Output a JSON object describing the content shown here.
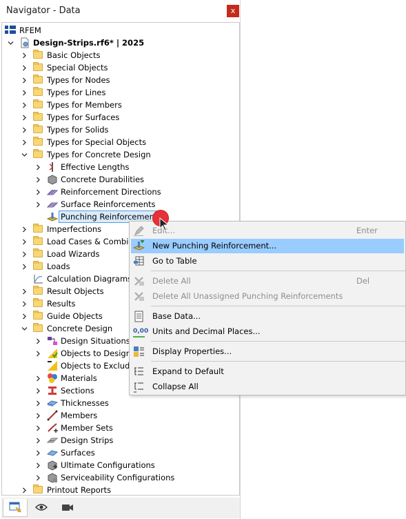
{
  "window": {
    "title": "Navigator - Data",
    "close_label": "x"
  },
  "tree": {
    "root_label": "RFEM",
    "project_label": "Design-Strips.rf6* | 2025",
    "rows": [
      {
        "label": "Basic Objects",
        "icon": "folder-icon"
      },
      {
        "label": "Special Objects",
        "icon": "folder-icon"
      },
      {
        "label": "Types for Nodes",
        "icon": "folder-icon"
      },
      {
        "label": "Types for Lines",
        "icon": "folder-icon"
      },
      {
        "label": "Types for Members",
        "icon": "folder-icon"
      },
      {
        "label": "Types for Surfaces",
        "icon": "folder-icon"
      },
      {
        "label": "Types for Solids",
        "icon": "folder-icon"
      },
      {
        "label": "Types for Special Objects",
        "icon": "folder-icon"
      },
      {
        "label": "Types for Concrete Design",
        "icon": "folder-icon"
      },
      {
        "label": "Effective Lengths",
        "icon": "effective-lengths-icon"
      },
      {
        "label": "Concrete Durabilities",
        "icon": "concrete-durability-icon"
      },
      {
        "label": "Reinforcement Directions",
        "icon": "reinforcement-directions-icon"
      },
      {
        "label": "Surface Reinforcements",
        "icon": "surface-reinforcement-icon"
      },
      {
        "label": "Punching Reinforcements",
        "icon": "punching-reinforcement-icon"
      },
      {
        "label": "Imperfections",
        "icon": "folder-icon"
      },
      {
        "label": "Load Cases & Combina",
        "icon": "folder-icon"
      },
      {
        "label": "Load Wizards",
        "icon": "folder-icon"
      },
      {
        "label": "Loads",
        "icon": "folder-icon"
      },
      {
        "label": "Calculation Diagrams",
        "icon": "diagram-icon"
      },
      {
        "label": "Result Objects",
        "icon": "folder-icon"
      },
      {
        "label": "Results",
        "icon": "folder-icon"
      },
      {
        "label": "Guide Objects",
        "icon": "folder-icon"
      },
      {
        "label": "Concrete Design",
        "icon": "folder-icon"
      },
      {
        "label": "Design Situations",
        "icon": "design-situations-icon"
      },
      {
        "label": "Objects to Design",
        "icon": "objects-to-design-icon"
      },
      {
        "label": "Objects to Exclude",
        "icon": "objects-to-exclude-icon"
      },
      {
        "label": "Materials",
        "icon": "materials-icon"
      },
      {
        "label": "Sections",
        "icon": "sections-icon"
      },
      {
        "label": "Thicknesses",
        "icon": "thickness-icon"
      },
      {
        "label": "Members",
        "icon": "member-icon"
      },
      {
        "label": "Member Sets",
        "icon": "member-set-icon"
      },
      {
        "label": "Design Strips",
        "icon": "design-strip-icon"
      },
      {
        "label": "Surfaces",
        "icon": "surface-icon"
      },
      {
        "label": "Ultimate Configurations",
        "icon": "ultimate-config-icon"
      },
      {
        "label": "Serviceability Configurations",
        "icon": "serviceability-config-icon"
      },
      {
        "label": "Printout Reports",
        "icon": "folder-icon"
      }
    ]
  },
  "context_menu": {
    "items": [
      {
        "label": "Edit...",
        "shortcut": "Enter",
        "icon": "edit-icon",
        "disabled": true
      },
      {
        "label": "New Punching Reinforcement...",
        "shortcut": "",
        "icon": "new-punching-icon",
        "disabled": false
      },
      {
        "label": "Go to Table",
        "shortcut": "",
        "icon": "table-icon",
        "disabled": false
      },
      {
        "label": "Delete All",
        "shortcut": "Del",
        "icon": "delete-icon",
        "disabled": true
      },
      {
        "label": "Delete All Unassigned Punching Reinforcements",
        "shortcut": "",
        "icon": "delete-unassigned-icon",
        "disabled": true
      },
      {
        "label": "Base Data...",
        "shortcut": "",
        "icon": "base-data-icon",
        "disabled": false
      },
      {
        "label": "Units and Decimal Places...",
        "shortcut": "",
        "icon": "units-icon",
        "disabled": false
      },
      {
        "label": "Display Properties...",
        "shortcut": "",
        "icon": "display-properties-icon",
        "disabled": false
      },
      {
        "label": "Expand to Default",
        "shortcut": "",
        "icon": "expand-icon",
        "disabled": false
      },
      {
        "label": "Collapse All",
        "shortcut": "",
        "icon": "collapse-icon",
        "disabled": false
      }
    ],
    "units_icon_text": "0,00"
  },
  "bottom_tabs": [
    {
      "icon": "data-navigator-icon"
    },
    {
      "icon": "eye-icon"
    },
    {
      "icon": "camera-icon"
    }
  ],
  "colors": {
    "accent": "#99ccff",
    "selection": "#d9ebfb",
    "close": "#c42b1c",
    "folder": "#f8d775"
  }
}
